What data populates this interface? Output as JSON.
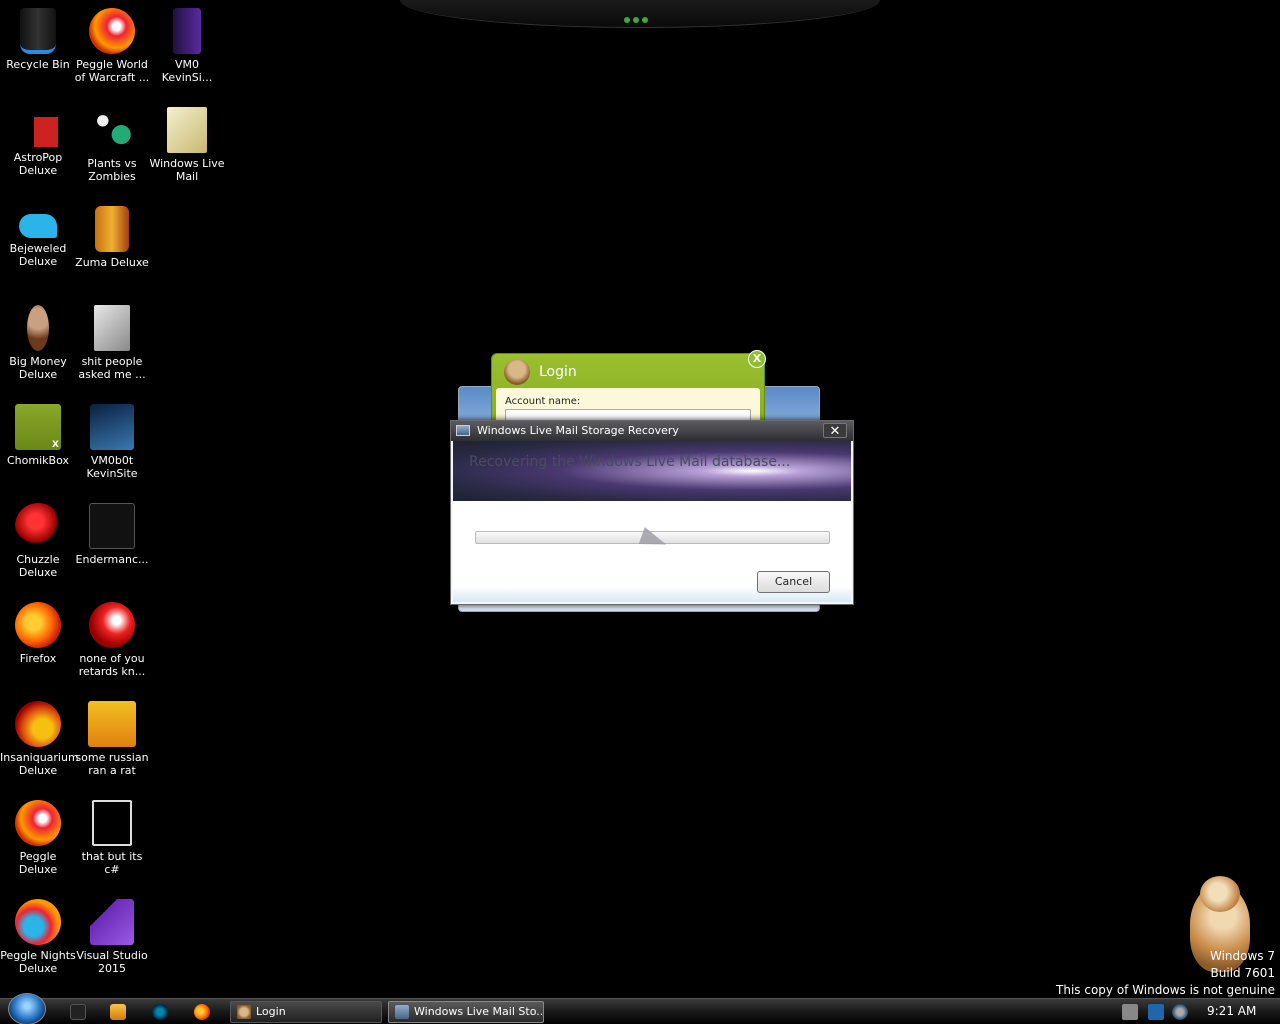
{
  "desktop": {
    "icons": [
      {
        "label": "Recycle Bin",
        "icon": "recycle-bin-icon"
      },
      {
        "label": "Peggle World\nof Warcraft ...",
        "icon": "peggle-world-of-warcraft-icon"
      },
      {
        "label": "VM0\nKevinSi...",
        "icon": "vm0-kevinsite-icon"
      },
      {
        "label": "AstroPop\nDeluxe",
        "icon": "astropop-deluxe-icon"
      },
      {
        "label": "Plants vs\nZombies",
        "icon": "plants-vs-zombies-icon"
      },
      {
        "label": "Windows Live\nMail",
        "icon": "windows-live-mail-icon"
      },
      {
        "label": "Bejeweled\nDeluxe",
        "icon": "bejeweled-deluxe-icon"
      },
      {
        "label": "Zuma Deluxe",
        "icon": "zuma-deluxe-icon"
      },
      {
        "label": "Big Money\nDeluxe",
        "icon": "big-money-deluxe-icon"
      },
      {
        "label": "shit people\nasked me ...",
        "icon": "folder-icon"
      },
      {
        "label": "ChomikBox",
        "icon": "chomikbox-icon"
      },
      {
        "label": "VM0b0t\nKevinSite",
        "icon": "vm0b0t-kevinsite-icon"
      },
      {
        "label": "Chuzzle\nDeluxe",
        "icon": "chuzzle-deluxe-icon"
      },
      {
        "label": "Endermanc...",
        "icon": "endermanch-icon"
      },
      {
        "label": "Firefox",
        "icon": "firefox-icon"
      },
      {
        "label": "none of you\nretards kn...",
        "icon": "peggle-shortcut-icon"
      },
      {
        "label": "Insaniquarium\nDeluxe",
        "icon": "insaniquarium-deluxe-icon"
      },
      {
        "label": "some russian\nran a rat",
        "icon": "russian-rat-icon"
      },
      {
        "label": "Peggle\nDeluxe",
        "icon": "peggle-deluxe-icon"
      },
      {
        "label": "that but its c#",
        "icon": "blank-shortcut-icon"
      },
      {
        "label": "Peggle Nights\nDeluxe",
        "icon": "peggle-nights-deluxe-icon"
      },
      {
        "label": "Visual Studio\n2015",
        "icon": "visual-studio-2015-icon"
      }
    ]
  },
  "login_window": {
    "title": "Login",
    "close_glyph": "X",
    "account_label": "Account name:"
  },
  "recovery_dialog": {
    "title": "Windows Live Mail Storage Recovery",
    "close_glyph": "✕",
    "banner_text": "Recovering the Windows Live Mail database...",
    "progress": 0.0,
    "cancel_label": "Cancel"
  },
  "watermark": {
    "line1": "Windows 7",
    "line2": "Build 7601",
    "line3": "This copy of Windows is not genuine"
  },
  "taskbar": {
    "tasks": [
      {
        "label": "Login"
      },
      {
        "label": "Windows Live Mail Sto..."
      }
    ],
    "clock": "9:21 AM"
  }
}
